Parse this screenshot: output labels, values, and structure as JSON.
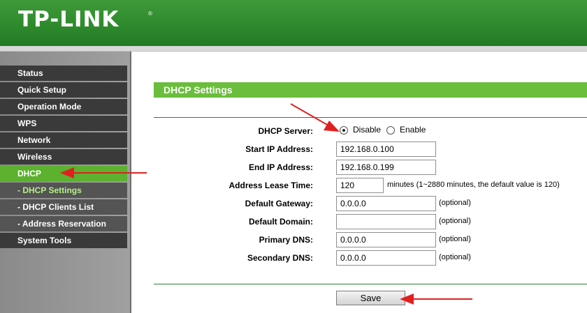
{
  "brand": {
    "logo": "TP-LINK",
    "registered": "®"
  },
  "sidebar": {
    "items": [
      {
        "label": "Status"
      },
      {
        "label": "Quick Setup"
      },
      {
        "label": "Operation Mode"
      },
      {
        "label": "WPS"
      },
      {
        "label": "Network"
      },
      {
        "label": "Wireless"
      },
      {
        "label": "DHCP"
      },
      {
        "label": "- DHCP Settings"
      },
      {
        "label": "- DHCP Clients List"
      },
      {
        "label": "- Address Reservation"
      },
      {
        "label": "System Tools"
      }
    ],
    "active_item": "DHCP",
    "current_subitem": "- DHCP Settings"
  },
  "main": {
    "title": "DHCP Settings",
    "dhcp_server": {
      "label": "DHCP Server:",
      "options": [
        "Disable",
        "Enable"
      ],
      "selected": "Disable"
    },
    "fields": {
      "start_ip": {
        "label": "Start IP Address:",
        "value": "192.168.0.100"
      },
      "end_ip": {
        "label": "End IP Address:",
        "value": "192.168.0.199"
      },
      "lease_time": {
        "label": "Address Lease Time:",
        "value": "120",
        "hint": "minutes (1~2880 minutes, the default value is 120)"
      },
      "gateway": {
        "label": "Default Gateway:",
        "value": "0.0.0.0",
        "hint": "(optional)"
      },
      "domain": {
        "label": "Default Domain:",
        "value": "",
        "hint": "(optional)"
      },
      "primary_dns": {
        "label": "Primary DNS:",
        "value": "0.0.0.0",
        "hint": "(optional)"
      },
      "secondary_dns": {
        "label": "Secondary DNS:",
        "value": "0.0.0.0",
        "hint": "(optional)"
      }
    },
    "save_label": "Save"
  },
  "annotations": {
    "arrow_color": "#e02020"
  },
  "colors": {
    "header_green": "#2f8a2d",
    "section_green": "#6abe3b",
    "active_green": "#5cb12f"
  }
}
